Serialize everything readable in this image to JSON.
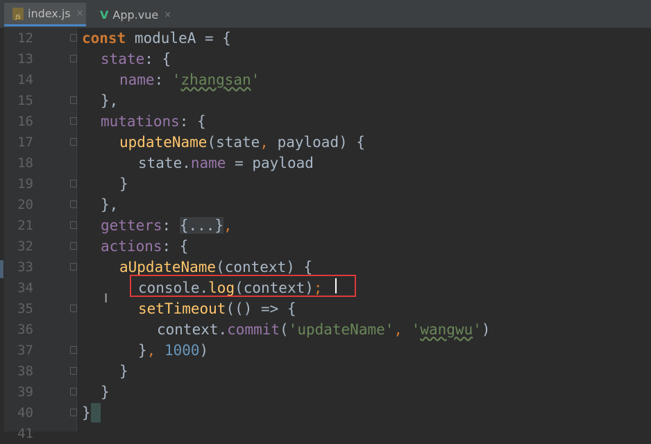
{
  "tabs": [
    {
      "label": "index.js",
      "icon": "js-file-icon",
      "active": true
    },
    {
      "label": "App.vue",
      "icon": "vue-file-icon",
      "active": false
    }
  ],
  "close_glyph": "×",
  "lines": [
    {
      "num": "12"
    },
    {
      "num": "13"
    },
    {
      "num": "14"
    },
    {
      "num": "15"
    },
    {
      "num": "16"
    },
    {
      "num": "17"
    },
    {
      "num": "18"
    },
    {
      "num": "19"
    },
    {
      "num": "20"
    },
    {
      "num": "21"
    },
    {
      "num": "32"
    },
    {
      "num": "33"
    },
    {
      "num": "34"
    },
    {
      "num": "35"
    },
    {
      "num": "36"
    },
    {
      "num": "37"
    },
    {
      "num": "38"
    },
    {
      "num": "39"
    },
    {
      "num": "40"
    },
    {
      "num": "41"
    }
  ],
  "code": {
    "l12": {
      "kw": "const",
      "rest": " moduleA = {"
    },
    "l13": {
      "prop": "state",
      "rest": ": {"
    },
    "l14": {
      "prop": "name",
      "colon": ": ",
      "q1": "'",
      "str": "zhangsan",
      "q2": "'"
    },
    "l15": {
      "rest": "},"
    },
    "l16": {
      "prop": "mutations",
      "rest": ": {"
    },
    "l17": {
      "fn": "updateName",
      "args": "(state",
      "comma": ",",
      "args2": " payload) {"
    },
    "l18": {
      "a": "state.",
      "prop": "name",
      "b": " = payload"
    },
    "l19": {
      "rest": "}"
    },
    "l20": {
      "rest": "},"
    },
    "l21": {
      "prop": "getters",
      "colon": ": ",
      "fold": "{...}",
      "comma": ","
    },
    "l32": {
      "prop": "actions",
      "rest": ": {"
    },
    "l33": {
      "fn": "aUpdateName",
      "rest": "(context) {"
    },
    "l34": {
      "a": "console.",
      "fn": "log",
      "b": "(context)",
      "semi": ";"
    },
    "l35": {
      "fn": "setTimeout",
      "rest": "(() => {"
    },
    "l36": {
      "a": "context.",
      "fn": "commit",
      "b": "(",
      "s1": "'updateName'",
      "comma": ",",
      "sp": " ",
      "s2q1": "'",
      "s2": "wangwu",
      "s2q2": "'",
      "c": ")"
    },
    "l37": {
      "a": "}",
      "comma": ",",
      "sp": " ",
      "num": "1000",
      "b": ")"
    },
    "l38": {
      "rest": "}"
    },
    "l39": {
      "rest": "}"
    },
    "l40": {
      "rest": "}"
    }
  },
  "colors": {
    "keyword": "#cc7832",
    "property": "#9876aa",
    "function": "#ffc66d",
    "string": "#6a8759",
    "number": "#6897bb",
    "highlight_box": "#e03a3a"
  }
}
